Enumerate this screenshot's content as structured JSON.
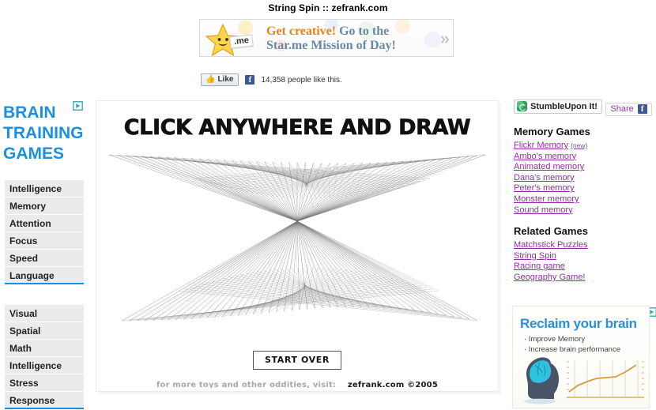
{
  "page": {
    "title": "String Spin :: zefrank.com"
  },
  "banner": {
    "logo_tag": ".me",
    "line1_strong": "Get creative!",
    "line1_rest": " Go to the",
    "line2": "Star.me Mission of Day!",
    "chevrons": "»"
  },
  "social": {
    "like_label": "Like",
    "count_text": "14,358 people like this.",
    "fb_letter": "f"
  },
  "left_ad": {
    "title_line1": "BRAIN",
    "title_line2": "TRAINING",
    "title_line3": "GAMES",
    "group_one": [
      "Intelligence",
      "Memory",
      "Attention",
      "Focus",
      "Speed",
      "Language"
    ],
    "group_two": [
      "Visual",
      "Spatial",
      "Math",
      "Intelligence",
      "Stress",
      "Response"
    ]
  },
  "main": {
    "headline": "CLICK ANYWHERE AND DRAW",
    "start_over_label": "START OVER",
    "footer_prefix": "for more toys and other oddities, visit:",
    "footer_brand": "zefrank.com ©2005"
  },
  "right": {
    "stumbleupon_label": "StumbleUpon It!",
    "share_label": "Share",
    "fb_letter": "f",
    "memory_heading": "Memory Games",
    "memory_links": [
      {
        "label": "Flickr Memory",
        "tag": "(new)"
      },
      {
        "label": "Ambo's memory",
        "tag": ""
      },
      {
        "label": "Animated memory",
        "tag": ""
      },
      {
        "label": "Dana's memory",
        "tag": ""
      },
      {
        "label": "Peter's memory",
        "tag": ""
      },
      {
        "label": "Monster memory",
        "tag": ""
      },
      {
        "label": "Sound memory",
        "tag": ""
      }
    ],
    "related_heading": "Related Games",
    "related_links": [
      {
        "label": "Matchstick Puzzles"
      },
      {
        "label": "String Spin"
      },
      {
        "label": "Racing game"
      },
      {
        "label": "Geography Game!"
      }
    ]
  },
  "brain_ad": {
    "title": "Reclaim your brain",
    "bullet1": "· Improve Memory",
    "bullet2": "· Increase brain performance"
  },
  "colors": {
    "link_purple": "#8f2fa3",
    "brand_blue": "#1b8fe0",
    "accent_orange": "#e8820c",
    "ad_orange": "#d79a3f",
    "fb_blue": "#3b5998"
  }
}
